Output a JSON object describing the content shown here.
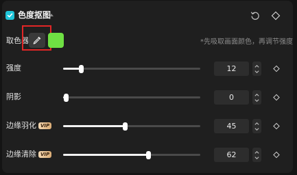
{
  "section": {
    "title": "色度抠图",
    "enabled": true,
    "accent_color": "#1fc4d8"
  },
  "header_icons": [
    "reset-icon",
    "keyframe-diamond-icon"
  ],
  "color_picker": {
    "label": "取色器",
    "icon": "eyedropper-icon",
    "selected_color": "#6fe043",
    "hint": "*先吸取画面颜色，再调节强度",
    "highlight_color": "#e32626"
  },
  "sliders": [
    {
      "label": "强度",
      "value": "12",
      "fraction": 0.13,
      "vip": false
    },
    {
      "label": "阴影",
      "value": "0",
      "fraction": 0.02,
      "vip": false
    },
    {
      "label": "边缘羽化",
      "value": "45",
      "fraction": 0.45,
      "vip": true
    },
    {
      "label": "边缘清除",
      "value": "62",
      "fraction": 0.62,
      "vip": true
    }
  ],
  "vip_badge": "VIP"
}
